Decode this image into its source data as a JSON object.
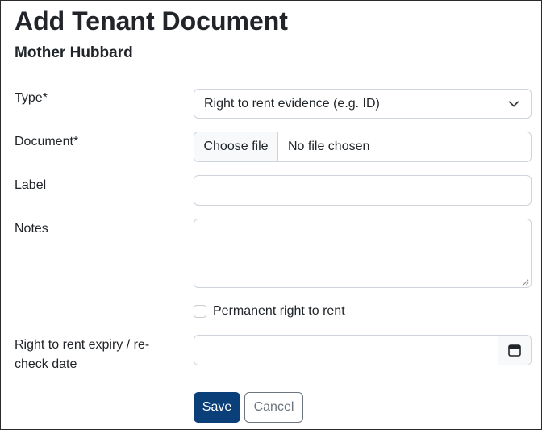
{
  "page": {
    "title": "Add Tenant Document",
    "subtitle": "Mother Hubbard"
  },
  "form": {
    "type": {
      "label": "Type*",
      "selected": "Right to rent evidence (e.g. ID)"
    },
    "document": {
      "label": "Document*",
      "button_label": "Choose file",
      "status": "No file chosen"
    },
    "label_field": {
      "label": "Label",
      "value": ""
    },
    "notes": {
      "label": "Notes",
      "value": ""
    },
    "permanent": {
      "label": "Permanent right to rent",
      "checked": false
    },
    "expiry": {
      "label_line1": "Right to rent expiry / re-",
      "label_line2": "check date",
      "value": "",
      "icon": "calendar-icon"
    }
  },
  "actions": {
    "save_label": "Save",
    "cancel_label": "Cancel"
  },
  "colors": {
    "primary": "#0a3f7a",
    "secondary": "#6c757d",
    "border": "#ced4da"
  }
}
